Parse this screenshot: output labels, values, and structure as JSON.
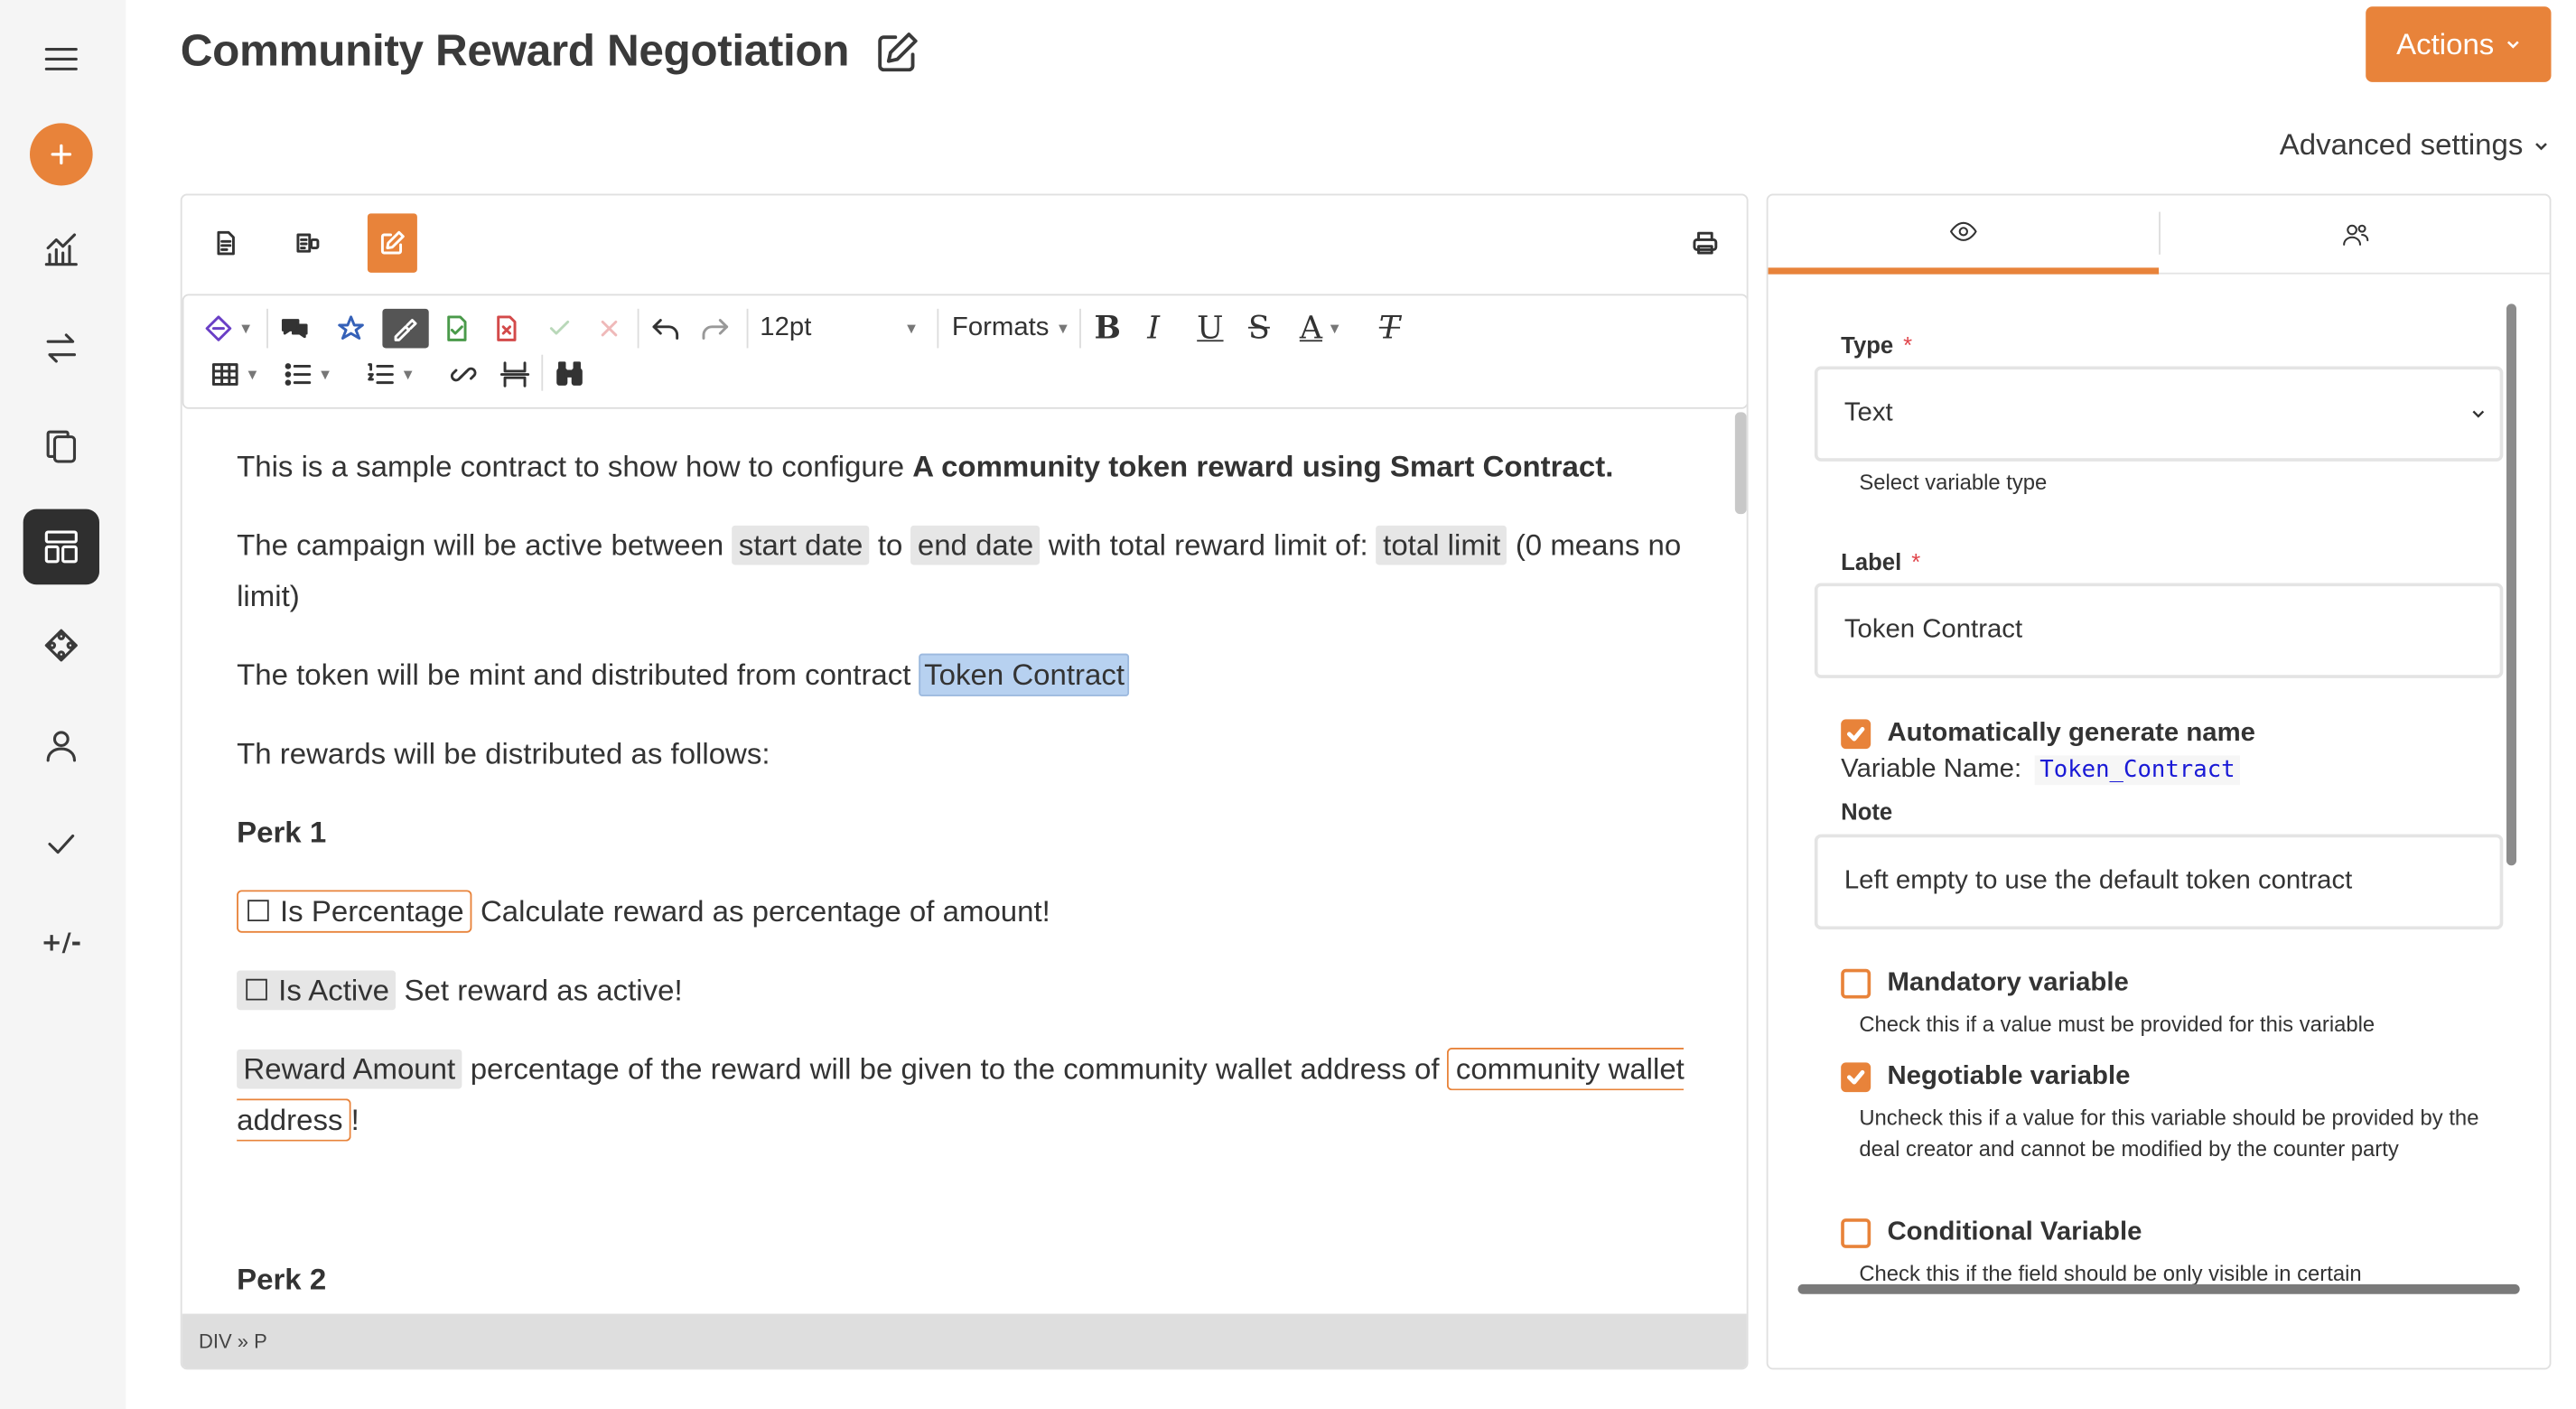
{
  "page": {
    "title": "Community Reward Negotiation",
    "actions_label": "Actions",
    "advanced_settings_label": "Advanced settings"
  },
  "sidebar": {
    "items": [
      {
        "name": "menu",
        "icon": "hamburger-icon"
      },
      {
        "name": "add",
        "icon": "plus-icon"
      },
      {
        "name": "analytics",
        "icon": "chart-icon"
      },
      {
        "name": "transfers",
        "icon": "arrows-icon"
      },
      {
        "name": "documents",
        "icon": "documents-icon"
      },
      {
        "name": "templates",
        "icon": "dashboard-icon",
        "active": true
      },
      {
        "name": "integrations",
        "icon": "network-icon"
      },
      {
        "name": "profile",
        "icon": "user-icon"
      },
      {
        "name": "approvals",
        "icon": "check-icon"
      },
      {
        "name": "diff",
        "icon": "plus-minus-icon",
        "text": "+/-"
      }
    ]
  },
  "toolbar": {
    "font_size": "12pt",
    "formats_label": "Formats"
  },
  "content": {
    "p1_prefix": "This is a sample contract to show how to configure ",
    "p1_bold": "A community token reward using Smart Contract.",
    "p2_a": "The campaign will be active between ",
    "var_start_date": "start date",
    "p2_b": " to ",
    "var_end_date": "end date",
    "p2_c": " with total reward limit of: ",
    "var_total_limit": "total limit",
    "p2_d": "  (0 means no limit)",
    "p3_a": "The token will be  mint and distributed from contract ",
    "var_token_contract": "Token Contract",
    "p4": "Th rewards will be distributed as follows:",
    "perk1": "Perk 1",
    "var_is_percentage": "☐ Is Percentage",
    "p5_b": " Calculate reward as percentage of amount!",
    "var_is_active": "☐ Is Active",
    "p6_b": " Set reward as active!",
    "var_reward_amount": "Reward Amount",
    "p7_b": " percentage  of the reward will be given to the community wallet address of ",
    "var_community_wallet": "community wallet address",
    "p7_c": "!",
    "perk2": "Perk 2"
  },
  "status_bar": {
    "path": "DIV » P"
  },
  "panel": {
    "type_label": "Type",
    "type_value": "Text",
    "type_help": "Select variable type",
    "label_label": "Label",
    "label_value": "Token Contract",
    "auto_name_label": "Automatically generate name",
    "auto_name_checked": true,
    "variable_name_label": "Variable Name:",
    "variable_name_value": "Token_Contract",
    "note_label": "Note",
    "note_value": "Left empty to use the default token contract",
    "mandatory_label": "Mandatory variable",
    "mandatory_checked": false,
    "mandatory_help": "Check this if a value must be provided for this variable",
    "negotiable_label": "Negotiable variable",
    "negotiable_checked": true,
    "negotiable_help": "Uncheck this if a value for this variable should be provided by the deal creator and cannot be modified by the counter party",
    "conditional_label": "Conditional Variable",
    "conditional_checked": false,
    "conditional_help": "Check this if the field should be only visible in certain"
  },
  "colors": {
    "accent": "#e8833a",
    "sidebar_bg": "#f5f5f5",
    "active_nav": "#2f2f2f",
    "selection": "#b7d1f0",
    "variable_code": "#1a1ad6"
  }
}
